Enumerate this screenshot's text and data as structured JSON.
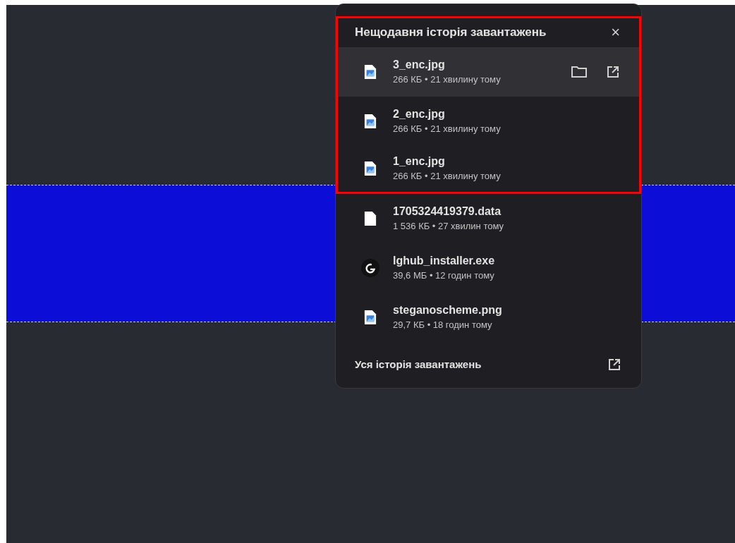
{
  "downloads_popup": {
    "title": "Нещодавня історія завантажень",
    "close": "×",
    "items": [
      {
        "name": "3_enc.jpg",
        "meta": "266 КБ • 21 хвилину тому",
        "kind": "image",
        "selected": true
      },
      {
        "name": "2_enc.jpg",
        "meta": "266 КБ • 21 хвилину тому",
        "kind": "image",
        "selected": false
      },
      {
        "name": "1_enc.jpg",
        "meta": "266 КБ • 21 хвилину тому",
        "kind": "image",
        "selected": false
      },
      {
        "name": "1705324419379.data",
        "meta": "1 536 КБ • 27 хвилин тому",
        "kind": "file",
        "selected": false
      },
      {
        "name": "lghub_installer.exe",
        "meta": "39,6 МБ • 12 годин тому",
        "kind": "app",
        "selected": false
      },
      {
        "name": "steganoscheme.png",
        "meta": "29,7 КБ • 18 годин тому",
        "kind": "image",
        "selected": false
      }
    ],
    "footer": "Уся історія завантажень"
  }
}
